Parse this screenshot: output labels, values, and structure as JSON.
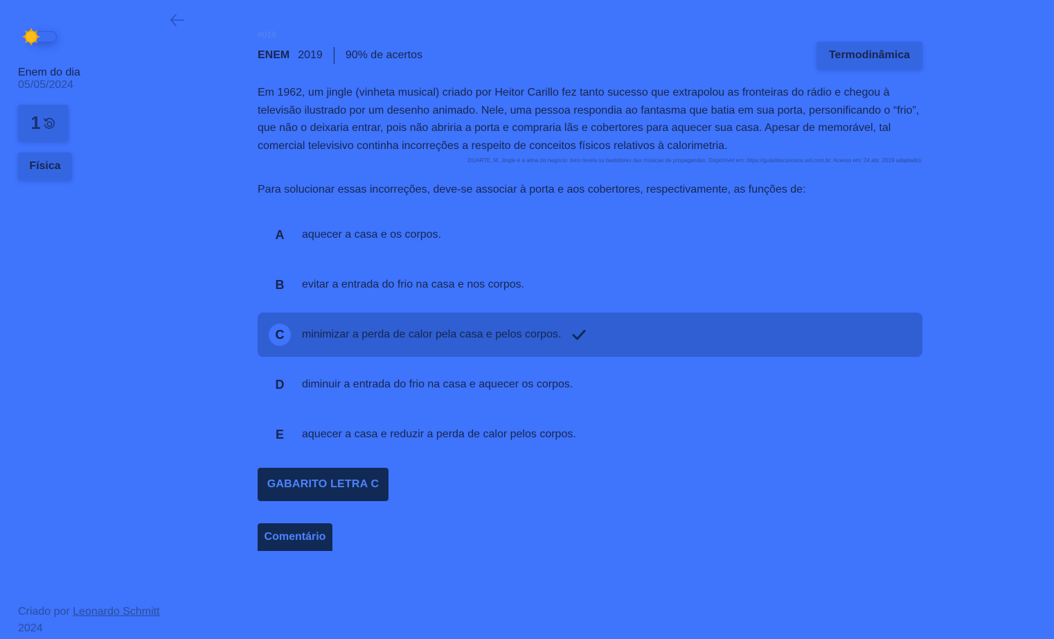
{
  "sidebar": {
    "day_title": "Enem do dia",
    "day_date": "05/05/2024",
    "streak_count": "1",
    "subject": "Física",
    "credits_prefix": "Criado por",
    "credits_author": "Leonardo Schmitt",
    "credits_year": "2024"
  },
  "question": {
    "number": "#019",
    "exam": "ENEM",
    "year": "2019",
    "accuracy": "90% de acertos",
    "topic": "Termodinâmica",
    "statement": "Em 1962, um jingle (vinheta musical) criado por Heitor Carillo fez tanto sucesso que extrapolou as fronteiras do rádio e chegou à televisão ilustrado por um desenho animado. Nele, uma pessoa respondia ao fantasma que batia em sua porta, personificando o “frio”, que não o deixaria entrar, pois não abriria a porta e compraria lãs e cobertores para aquecer sua casa. Apesar de memorável, tal comercial televisivo continha incorreções a respeito de conceitos físicos relativos à calorimetria.",
    "source": "DUARTE, M. Jingle é a alma do negócio: livro revela os bastidores das músicas de propagandas. Disponível em: https://guiadoscuriosos.uol.com.br. Acesso em: 24 abr. 2019 adaptado).",
    "command": "Para solucionar essas incorreções, deve-se associar à porta e aos cobertores, respectivamente, as funções de:",
    "alternatives": [
      {
        "letter": "A",
        "text": "aquecer a casa e os corpos."
      },
      {
        "letter": "B",
        "text": "evitar a entrada do frio na casa e nos corpos."
      },
      {
        "letter": "C",
        "text": "minimizar a perda de calor pela casa e pelos corpos."
      },
      {
        "letter": "D",
        "text": "diminuir a entrada do frio na casa e aquecer os corpos."
      },
      {
        "letter": "E",
        "text": "aquecer a casa e reduzir a perda de calor pelos corpos."
      }
    ],
    "answer_label": "GABARITO LETRA C",
    "comment_label": "Comentário"
  },
  "icons": {
    "theme": "sun-icon",
    "back": "arrow-left-icon",
    "streak": "clock-rotate-icon",
    "correct": "check-icon"
  },
  "colors": {
    "background": "#3f74fd",
    "accent_dark": "#102a55",
    "sun": "#f5a800"
  }
}
